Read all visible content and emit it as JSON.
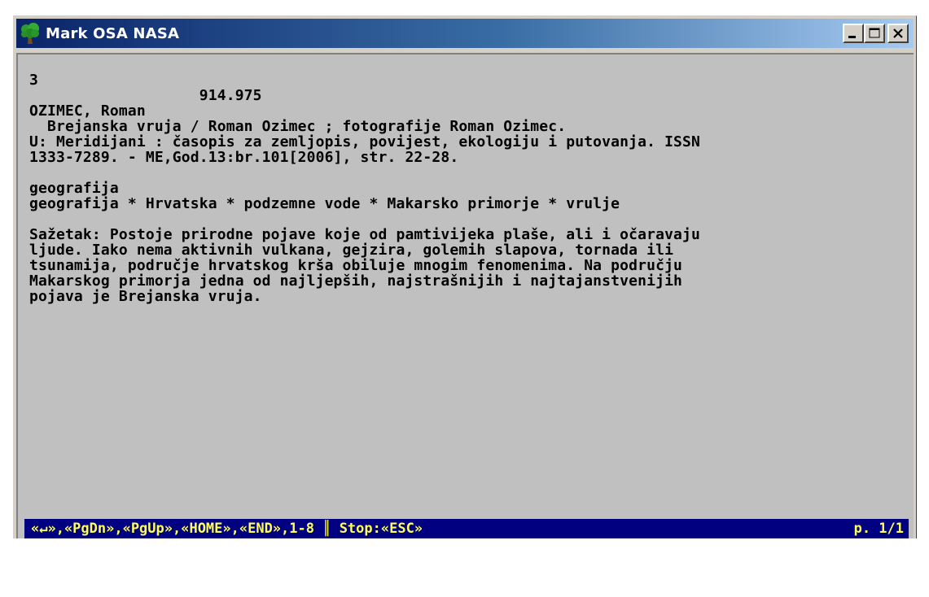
{
  "window": {
    "title": "Mark OSA NASA",
    "buttons": {
      "minimize": "minimize",
      "maximize": "maximize",
      "close": "close"
    }
  },
  "record": {
    "lines": [
      "3",
      "                   914.975",
      "OZIMEC, Roman",
      "  Brejanska vruja / Roman Ozimec ; fotografije Roman Ozimec.",
      "U: Meridijani : časopis za zemljopis, povijest, ekologiju i putovanja. ISSN",
      "1333-7289. - ME,God.13:br.101[2006], str. 22-28.",
      "",
      "geografija",
      "geografija * Hrvatska * podzemne vode * Makarsko primorje * vrulje",
      "",
      "Sažetak: Postoje prirodne pojave koje od pamtivijeka plaše, ali i očaravaju",
      "ljude. Iako nema aktivnih vulkana, gejzira, golemih slapova, tornada ili",
      "tsunamija, područje hrvatskog krša obiluje mnogim fenomenima. Na području",
      "Makarskog primorja jedna od najljepših, najstrašnijih i najtajanstvenijih",
      "pojava je Brejanska vruja."
    ]
  },
  "statusbar": {
    "keys": "«↵»,«PgDn»,«PgUp»,«HOME»,«END»,1-8 ║ Stop:«ESC»",
    "page": "p. 1/1"
  },
  "colors": {
    "title_gradient_start": "#0a246a",
    "title_gradient_end": "#a6caf0",
    "console_bg": "#c0c0c0",
    "status_bg": "#000080",
    "status_fg": "#ffff55"
  },
  "icons": {
    "app": "tree-icon"
  }
}
